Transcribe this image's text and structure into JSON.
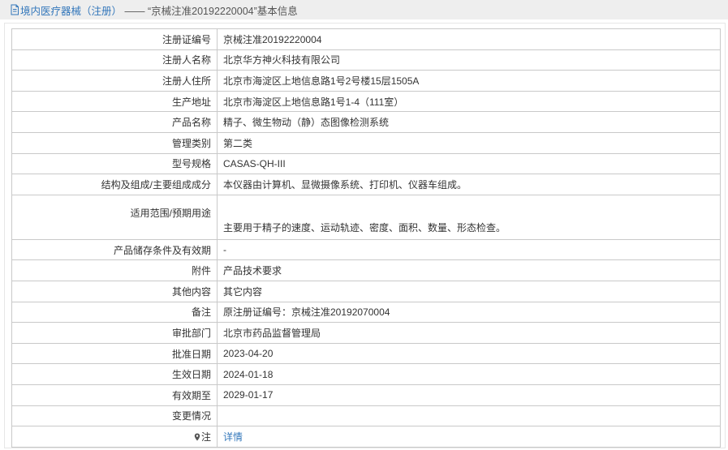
{
  "header": {
    "breadcrumb_link": "境内医疗器械（注册）",
    "separator": " ——",
    "record_title": "“京械注准20192220004”基本信息"
  },
  "rows": [
    {
      "label": "注册证编号",
      "value": "京械注准20192220004"
    },
    {
      "label": "注册人名称",
      "value": "北京华方神火科技有限公司"
    },
    {
      "label": "注册人住所",
      "value": "北京市海淀区上地信息路1号2号楼15层1505A"
    },
    {
      "label": "生产地址",
      "value": "北京市海淀区上地信息路1号1-4（111室）"
    },
    {
      "label": "产品名称",
      "value": "精子、微生物动（静）态图像检测系统"
    },
    {
      "label": "管理类别",
      "value": "第二类"
    },
    {
      "label": "型号规格",
      "value": "CASAS-QH-III"
    },
    {
      "label": "结构及组成/主要组成成分",
      "value": "本仪器由计算机、显微摄像系统、打印机、仪器车组成。"
    },
    {
      "label": "适用范围/预期用途",
      "value": "主要用于精子的速度、运动轨迹、密度、面积、数量、形态检查。"
    },
    {
      "label": "产品储存条件及有效期",
      "value": "-"
    },
    {
      "label": "附件",
      "value": "产品技术要求"
    },
    {
      "label": "其他内容",
      "value": "其它内容"
    },
    {
      "label": "备注",
      "value": "原注册证编号：京械注准20192070004"
    },
    {
      "label": "审批部门",
      "value": "北京市药品监督管理局"
    },
    {
      "label": "批准日期",
      "value": "2023-04-20"
    },
    {
      "label": "生效日期",
      "value": "2024-01-18"
    },
    {
      "label": "有效期至",
      "value": "2029-01-17"
    },
    {
      "label": "变更情况",
      "value": ""
    },
    {
      "label": "注",
      "value": "详情"
    }
  ],
  "icons": {
    "header": "document-icon",
    "note": "map-pin-icon"
  },
  "colors": {
    "link": "#3377bb",
    "header_bg": "#eeeeee",
    "border": "#c9c9c9"
  }
}
